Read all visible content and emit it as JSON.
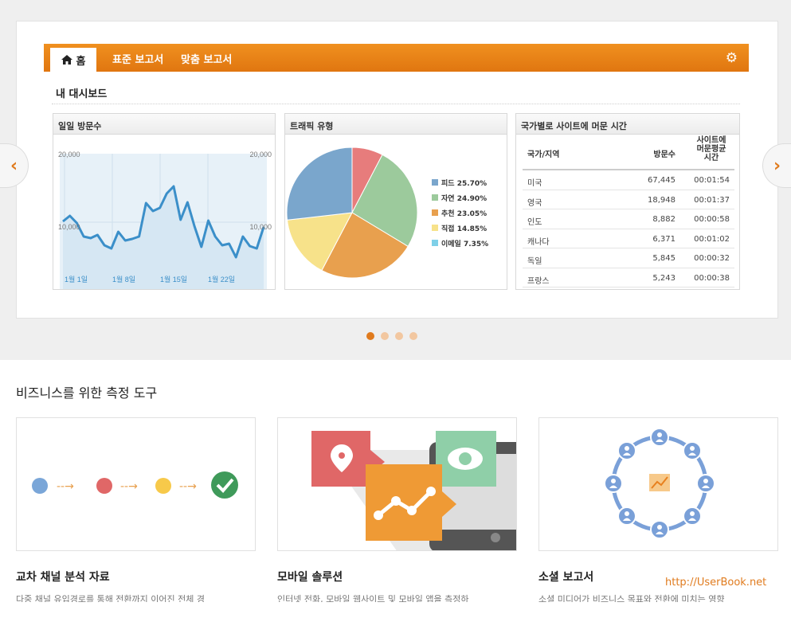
{
  "navbar": {
    "home_label": "홈",
    "tabs": [
      "표준 보고서",
      "맞춤 보고서"
    ]
  },
  "dashboard": {
    "title": "내 대시보드"
  },
  "daily_visits": {
    "title": "일일 방문수",
    "y_top_left": "20,000",
    "y_top_right": "20,000",
    "y_mid_left": "10,000",
    "y_mid_right": "10,000",
    "x_labels": [
      "1월 1일",
      "1월 8일",
      "1월 15일",
      "1월 22일"
    ]
  },
  "traffic": {
    "title": "트래픽 유형"
  },
  "country_table": {
    "title": "국가별로 사이트에 머문 시간",
    "headers": [
      "국가/지역",
      "방문수",
      "사이트에 머문평균 시간"
    ],
    "header_time_lines": [
      "사이트에",
      "머문평균",
      "시간"
    ],
    "rows": [
      [
        "미국",
        "67,445",
        "00:01:54"
      ],
      [
        "영국",
        "18,948",
        "00:01:37"
      ],
      [
        "인도",
        "8,882",
        "00:00:58"
      ],
      [
        "캐나다",
        "6,371",
        "00:01:02"
      ],
      [
        "독일",
        "5,845",
        "00:00:32"
      ],
      [
        "프랑스",
        "5,243",
        "00:00:38"
      ]
    ]
  },
  "chart_data": [
    {
      "type": "line",
      "title": "일일 방문수",
      "x": [
        "1월 1일",
        "1월 8일",
        "1월 15일",
        "1월 22일"
      ],
      "ylim": [
        5000,
        22000
      ],
      "y_ticks": [
        "10,000",
        "20,000"
      ],
      "values": [
        13500,
        14200,
        13300,
        11600,
        11400,
        11800,
        10500,
        10100,
        12200,
        11100,
        11300,
        11600,
        15800,
        14800,
        15200,
        17000,
        17900,
        13700,
        15900,
        12900,
        10300,
        13600,
        11600,
        10500,
        10700,
        9000,
        11600,
        10400,
        10100,
        12800
      ]
    },
    {
      "type": "pie",
      "title": "트래픽 유형",
      "labels": [
        "피드",
        "자연",
        "추천",
        "직접",
        "이메일"
      ],
      "values": [
        25.7,
        24.9,
        23.05,
        14.85,
        7.35
      ],
      "legend": [
        "피드 25.70%",
        "자연 24.90%",
        "추천 23.05%",
        "직접 14.85%",
        "이메일 7.35%"
      ],
      "colors": [
        "#7aa6cc",
        "#9cca9c",
        "#e8a04e",
        "#f7e28a",
        "#e77c7c"
      ]
    }
  ],
  "carousel": {
    "dots": 4,
    "active": 0
  },
  "section": {
    "title": "비즈니스를 위한 측정 도구"
  },
  "cards": [
    {
      "title": "교차 채널 분석 자료",
      "desc": "다중 채널 유입경로를 통해 전환까지 이어진 전체 경"
    },
    {
      "title": "모바일 솔루션",
      "desc": "인터넷 전화, 모바일 웹사이트 및 모바일 앱을 측정하"
    },
    {
      "title": "소셜 보고서",
      "desc": "소셜 미디어가 비즈니스 목표와 전환에 미치는 영향"
    }
  ],
  "watermark": "http://UserBook.net",
  "colors": {
    "accent": "#e07b1e",
    "line": "#3b8fc9"
  }
}
